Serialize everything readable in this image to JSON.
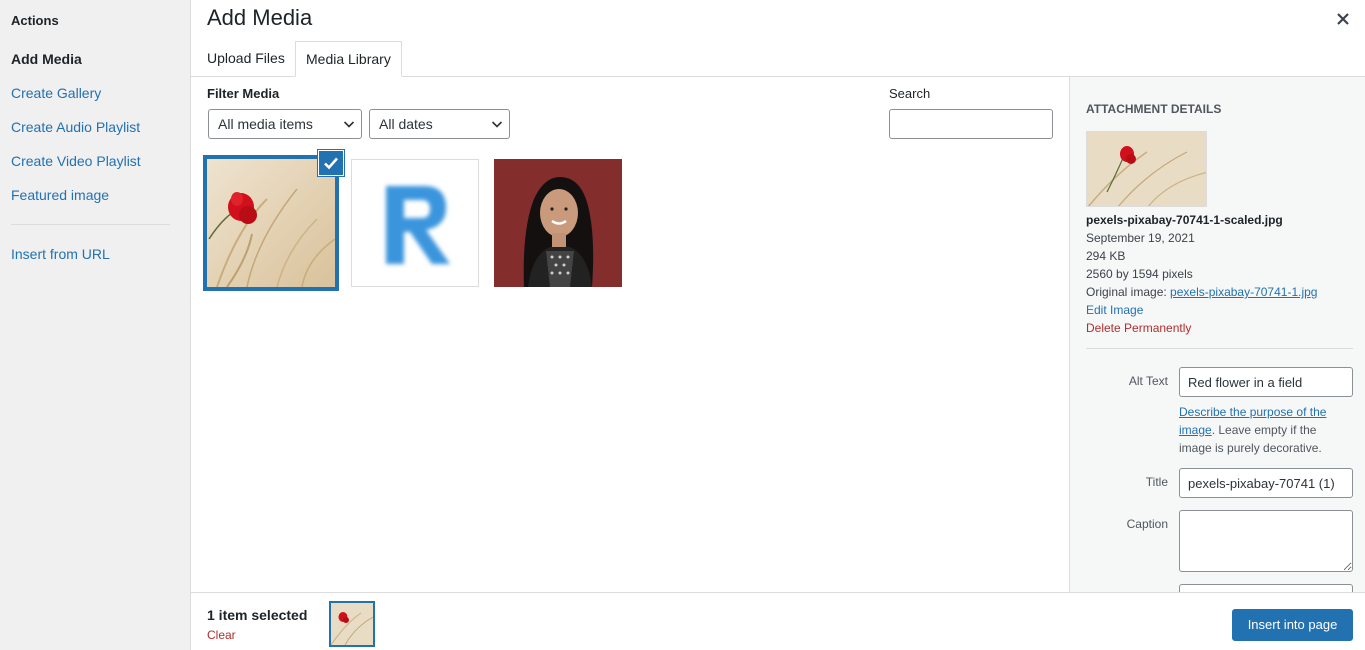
{
  "menu": {
    "title": "Actions",
    "items": [
      {
        "label": "Add Media"
      },
      {
        "label": "Create Gallery"
      },
      {
        "label": "Create Audio Playlist"
      },
      {
        "label": "Create Video Playlist"
      },
      {
        "label": "Featured image"
      },
      {
        "label": "Insert from URL"
      }
    ]
  },
  "header": {
    "title": "Add Media",
    "close_icon": "close-icon",
    "tabs": [
      {
        "label": "Upload Files"
      },
      {
        "label": "Media Library"
      }
    ]
  },
  "filters": {
    "label": "Filter Media",
    "type_select": "All media items",
    "date_select": "All dates",
    "search_label": "Search",
    "search_value": ""
  },
  "grid": {
    "items": [
      {
        "name": "poppy-flower-field",
        "selected": true
      },
      {
        "name": "blue-letter-r",
        "selected": false
      },
      {
        "name": "portrait-woman",
        "selected": false
      }
    ]
  },
  "details": {
    "heading": "Attachment Details",
    "filename": "pexels-pixabay-70741-1-scaled.jpg",
    "date": "September 19, 2021",
    "size": "294 KB",
    "dimensions": "2560 by 1594 pixels",
    "original_label": "Original image:",
    "original_link": "pexels-pixabay-70741-1.jpg",
    "edit_link": "Edit Image",
    "delete_link": "Delete Permanently",
    "alt_label": "Alt Text",
    "alt_value": "Red flower in a field",
    "alt_desc_link_1": "Describe the purpose of the",
    "alt_desc_link_2": "image",
    "alt_desc_text_1": ". Leave empty if the",
    "alt_desc_text_2": "image is purely decorative.",
    "title_label": "Title",
    "title_value": "pexels-pixabay-70741 (1)",
    "caption_label": "Caption",
    "caption_value": ""
  },
  "footer": {
    "count": "1 item selected",
    "clear": "Clear",
    "insert_button": "Insert into page"
  },
  "colors": {
    "accent": "#2271b1",
    "danger": "#b32d2e",
    "menu_bg": "#f0f0f1"
  }
}
